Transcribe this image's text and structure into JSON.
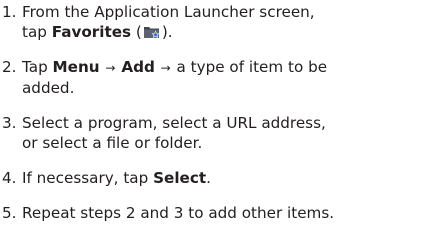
{
  "steps": [
    {
      "num": "1.",
      "line1_pre": "From the Application Launcher screen,",
      "line2_pre": "tap ",
      "bold": "Favorites",
      "line2_mid": " (",
      "icon": "favorites-folder-icon",
      "line2_post": ")."
    },
    {
      "num": "2.",
      "pre": "Tap ",
      "bold1": "Menu",
      "arrow1": "→",
      "bold2": "Add",
      "arrow2": "→",
      "line1_post": " a type of item to be",
      "line2": "added."
    },
    {
      "num": "3.",
      "line1": "Select a program, select a URL address,",
      "line2": "or select a file or folder."
    },
    {
      "num": "4.",
      "pre": "If necessary, tap ",
      "bold": "Select",
      "post": "."
    },
    {
      "num": "5.",
      "text": "Repeat steps 2 and 3 to add other items."
    }
  ],
  "colors": {
    "text": "#231f20",
    "icon_folder": "#3f4652",
    "icon_star": "#3a6fd1"
  }
}
